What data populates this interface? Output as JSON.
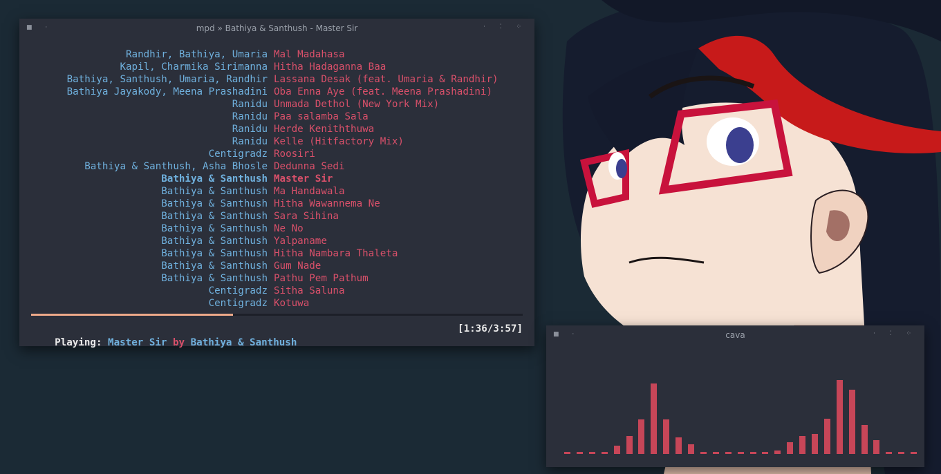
{
  "mpd_window": {
    "title": "mpd » Bathiya & Santhush - Master Sir",
    "playlist": [
      {
        "artist": "Randhir, Bathiya, Umaria",
        "song": "Mal Madahasa",
        "current": false
      },
      {
        "artist": "Kapil, Charmika Sirimanna",
        "song": "Hitha Hadaganna Baa",
        "current": false
      },
      {
        "artist": "Bathiya, Santhush, Umaria, Randhir",
        "song": "Lassana Desak (feat. Umaria & Randhir)",
        "current": false
      },
      {
        "artist": "Bathiya Jayakody, Meena Prashadini",
        "song": "Oba Enna Aye (feat. Meena Prashadini)",
        "current": false
      },
      {
        "artist": "Ranidu",
        "song": "Unmada Dethol (New York Mix)",
        "current": false
      },
      {
        "artist": "Ranidu",
        "song": "Paa salamba Sala",
        "current": false
      },
      {
        "artist": "Ranidu",
        "song": "Herde Keniththuwa",
        "current": false
      },
      {
        "artist": "Ranidu",
        "song": "Kelle (Hitfactory Mix)",
        "current": false
      },
      {
        "artist": "Centigradz",
        "song": "Roosiri",
        "current": false
      },
      {
        "artist": "Bathiya & Santhush, Asha Bhosle",
        "song": "Dedunna Sedi",
        "current": false
      },
      {
        "artist": "Bathiya & Santhush",
        "song": "Master Sir",
        "current": true
      },
      {
        "artist": "Bathiya & Santhush",
        "song": "Ma Handawala",
        "current": false
      },
      {
        "artist": "Bathiya & Santhush",
        "song": "Hitha Wawannema Ne",
        "current": false
      },
      {
        "artist": "Bathiya & Santhush",
        "song": "Sara Sihina",
        "current": false
      },
      {
        "artist": "Bathiya & Santhush",
        "song": "Ne No",
        "current": false
      },
      {
        "artist": "Bathiya & Santhush",
        "song": "Yalpaname",
        "current": false
      },
      {
        "artist": "Bathiya & Santhush",
        "song": "Hitha Nambara Thaleta",
        "current": false
      },
      {
        "artist": "Bathiya & Santhush",
        "song": "Gum Nade",
        "current": false
      },
      {
        "artist": "Bathiya & Santhush",
        "song": "Pathu Pem Pathum",
        "current": false
      },
      {
        "artist": "Centigradz",
        "song": "Sitha Saluna",
        "current": false
      },
      {
        "artist": "Centigradz",
        "song": "Kotuwa",
        "current": false
      }
    ],
    "progress_fraction": 0.41,
    "status": {
      "prefix": "Playing: ",
      "song": "Master Sir",
      "by": " by ",
      "artist": "Bathiya & Santhush",
      "time": "[1:36/3:57]"
    }
  },
  "cava_window": {
    "title": "cava",
    "levels": [
      0.02,
      0.02,
      0.02,
      0.02,
      0.08,
      0.17,
      0.33,
      0.68,
      0.33,
      0.16,
      0.09,
      0.02,
      0.02,
      0.02,
      0.02,
      0.02,
      0.02,
      0.03,
      0.11,
      0.17,
      0.19,
      0.34,
      0.71,
      0.62,
      0.28,
      0.13,
      0.02,
      0.02,
      0.02
    ]
  },
  "colors": {
    "artist": "#6fb0dd",
    "song": "#d9506a",
    "progress": "#eea989",
    "bars": "#c74658",
    "window_bg": "#2b2f3a"
  }
}
